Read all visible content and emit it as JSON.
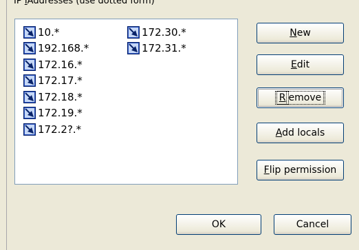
{
  "group_label": {
    "mnemonic": "I",
    "pre": "IP ",
    "rest": "Addresses (use dotted form)"
  },
  "ip_list": {
    "column1": [
      "10.*",
      "192.168.*",
      "172.16.*",
      "172.17.*",
      "172.18.*",
      "172.19.*",
      "172.2?.*"
    ],
    "column2": [
      "172.30.*",
      "172.31.*"
    ],
    "icon": "network-address-icon"
  },
  "buttons": {
    "new": {
      "mnemonic": "N",
      "rest": "ew"
    },
    "edit": {
      "mnemonic": "E",
      "rest": "dit"
    },
    "remove": {
      "mnemonic": "R",
      "rest": "emove"
    },
    "add_locals": {
      "mnemonic": "A",
      "rest": "dd locals"
    },
    "flip_permission": {
      "mnemonic": "F",
      "rest": "lip permission"
    },
    "ok": "OK",
    "cancel": "Cancel"
  },
  "colors": {
    "dialog_bg": "#ece9d8",
    "list_border": "#7f9db9",
    "button_border": "#003c74"
  }
}
